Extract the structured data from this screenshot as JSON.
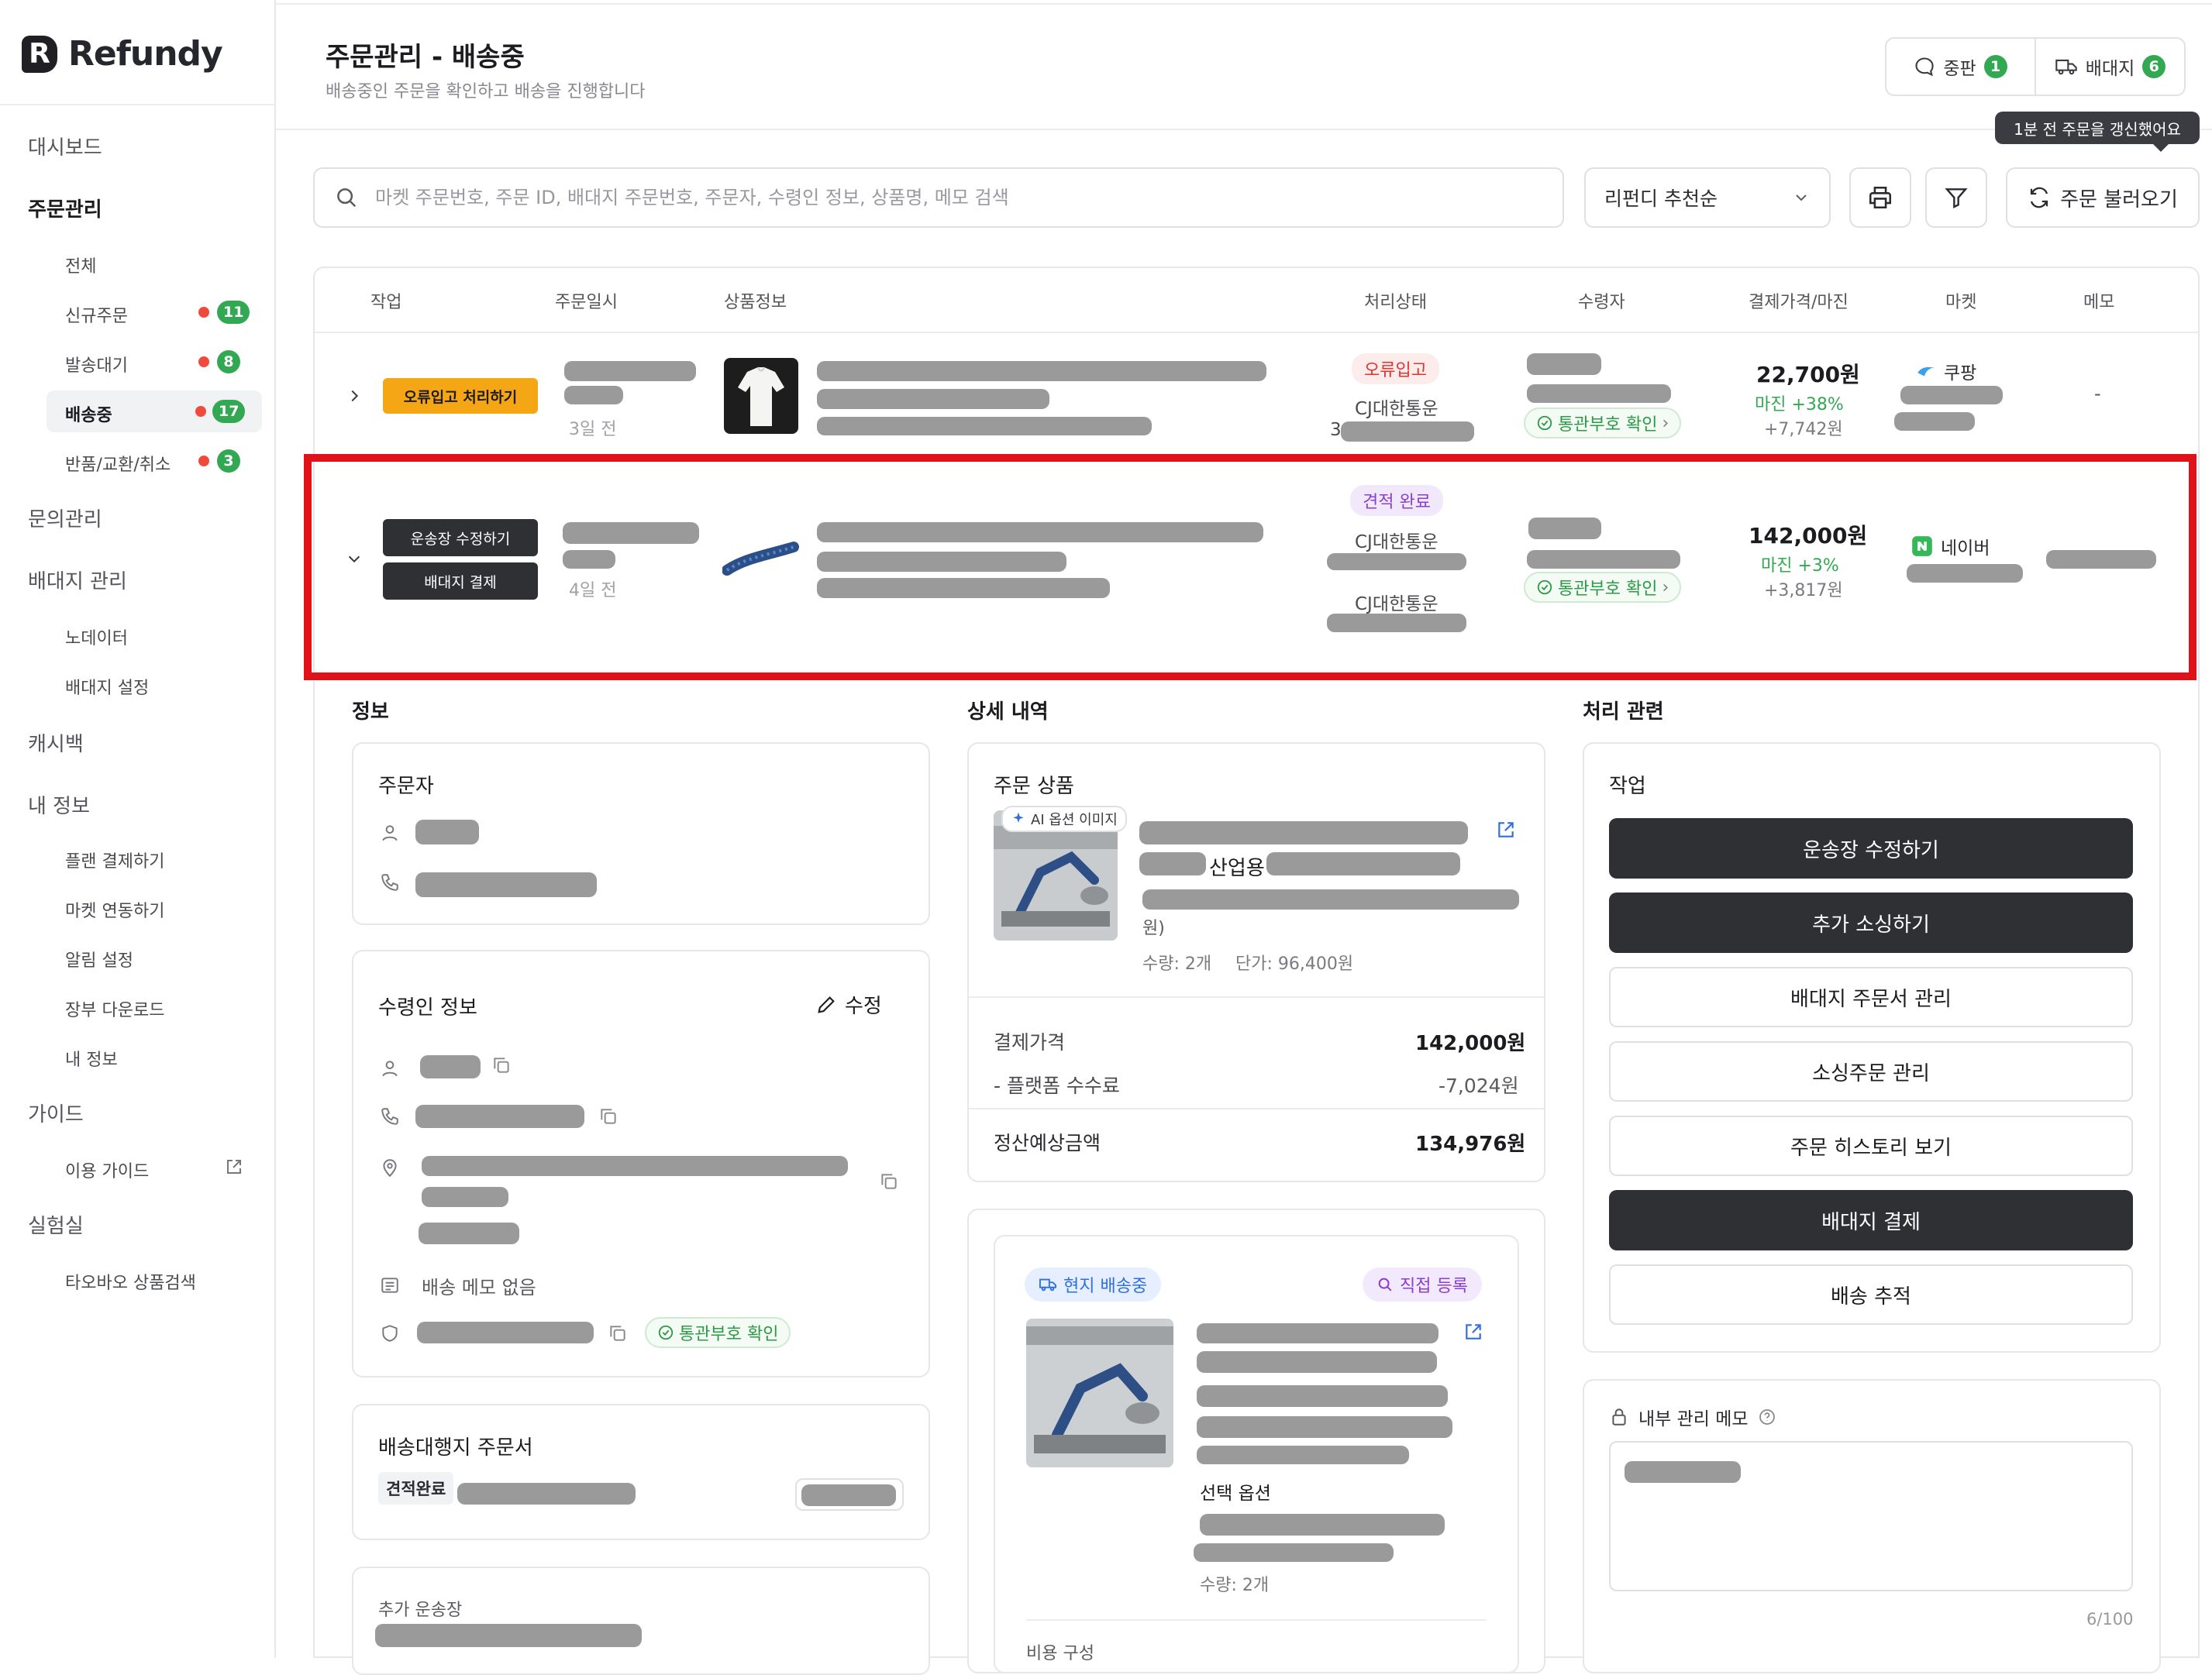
{
  "app": {
    "logo_letter": "R",
    "name": "Refundy"
  },
  "colors": {
    "accent_green": "#33a853",
    "highlight_red": "#e0131b",
    "dark_button": "#2f3034",
    "orange_button": "#f5a614"
  },
  "sidebar": {
    "dashboard": "대시보드",
    "orders": "주문관리",
    "order_items": [
      {
        "label": "전체"
      },
      {
        "label": "신규주문",
        "count": "11"
      },
      {
        "label": "발송대기",
        "count": "8"
      },
      {
        "label": "배송중",
        "count": "17"
      },
      {
        "label": "반품/교환/취소",
        "count": "3"
      }
    ],
    "inquiries": "문의관리",
    "dropship": "배대지 관리",
    "dropship_items": [
      "노데이터",
      "배대지 설정"
    ],
    "cashback": "캐시백",
    "my_info": "내 정보",
    "my_items": [
      "플랜 결제하기",
      "마켓 연동하기",
      "알림 설정",
      "장부 다운로드",
      "내 정보"
    ],
    "guide": "가이드",
    "guide_items": [
      "이용 가이드"
    ],
    "lab": "실험실",
    "lab_items": [
      "타오바오 상품검색"
    ]
  },
  "header": {
    "title": "주문관리 - 배송중",
    "subtitle": "배송중인 주문을 확인하고 배송을 진행합니다",
    "dispute_label": "중판",
    "dispute_count": "1",
    "dropship_label": "배대지",
    "dropship_count": "6",
    "tooltip": "1분 전 주문을 갱신했어요"
  },
  "toolbar": {
    "search_placeholder": "마켓 주문번호, 주문 ID, 배대지 주문번호, 주문자, 수령인 정보, 상품명, 메모 검색",
    "select_value": "리펀디 추천순",
    "refresh_label": "주문 불러오기"
  },
  "table": {
    "headers": [
      "작업",
      "주문일시",
      "상품정보",
      "처리상태",
      "수령자",
      "결제가격/마진",
      "마켓",
      "메모"
    ],
    "rows": [
      {
        "action": "오류입고 처리하기",
        "ago": "3일 전",
        "status": "오류입고",
        "carrier": "CJ대한통운",
        "carrier_prefix": "3",
        "customs": "통관부호 확인",
        "price": "22,700원",
        "margin": "마진 +38%",
        "margin_amount": "+7,742원",
        "market": "쿠팡",
        "memo": "-"
      },
      {
        "actions": [
          "운송장 수정하기",
          "배대지 결제"
        ],
        "ago": "4일 전",
        "status": "견적 완료",
        "carrier": "CJ대한통운",
        "carrier2": "CJ대한통운",
        "customs": "통관부호 확인",
        "price": "142,000원",
        "margin": "마진 +3%",
        "margin_amount": "+3,817원",
        "market": "네이버"
      }
    ]
  },
  "detail": {
    "info_title": "정보",
    "detail_title": "상세 내역",
    "process_title": "처리 관련",
    "orderer_title": "주문자",
    "recipient_title": "수령인 정보",
    "edit_label": "수정",
    "delivery_memo": "배송 메모 없음",
    "customs_label": "통관부호 확인",
    "agent_order_title": "배송대행지 주문서",
    "agent_status": "견적완료",
    "extra_tracking_title": "추가 운송장",
    "product_title": "주문 상품",
    "ai_badge": "AI 옵션 이미지",
    "product_word": "산업용",
    "product_suffix": "원)",
    "qty": "수량: 2개",
    "unit_price": "단가: 96,400원",
    "pay_label": "결제가격",
    "pay_value": "142,000원",
    "fee_label": "- 플랫폼 수수료",
    "fee_value": "-7,024원",
    "settle_label": "정산예상금액",
    "settle_value": "134,976원",
    "local_shipping": "현지 배송중",
    "direct_register": "직접 등록",
    "option_label": "선택 옵션",
    "qty2": "수량: 2개",
    "cost_label": "비용 구성",
    "work_title": "작업",
    "actions": [
      "운송장 수정하기",
      "추가 소싱하기",
      "배대지 주문서 관리",
      "소싱주문 관리",
      "주문 히스토리 보기",
      "배대지 결제",
      "배송 추적"
    ],
    "memo_title": "내부 관리 메모",
    "memo_count": "6/100"
  }
}
